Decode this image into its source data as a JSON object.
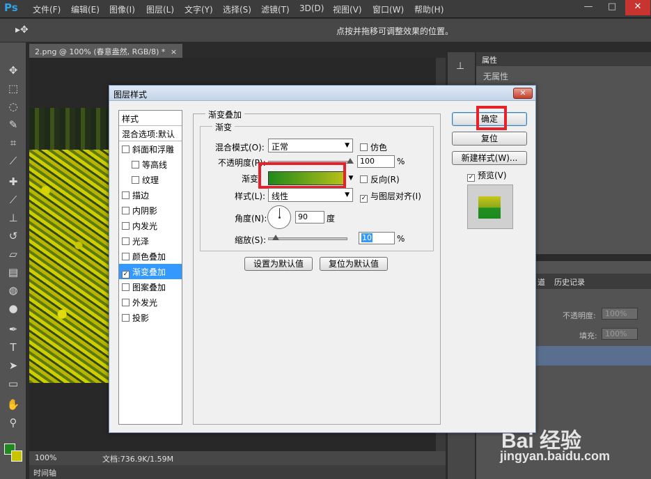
{
  "app": {
    "logo": "Ps",
    "menus": [
      "文件(F)",
      "编辑(E)",
      "图像(I)",
      "图层(L)",
      "文字(Y)",
      "选择(S)",
      "滤镜(T)",
      "3D(D)",
      "视图(V)",
      "窗口(W)",
      "帮助(H)"
    ],
    "window_buttons": [
      "—",
      "□",
      "✕"
    ]
  },
  "options_bar": {
    "hint": "点按并拖移可调整效果的位置。"
  },
  "document": {
    "tab_title": "2.png @ 100% (春意盎然, RGB/8) *",
    "tab_close": "×",
    "zoom": "100%",
    "doc_size": "文档:736.9K/1.59M",
    "timeline_tab": "时间轴"
  },
  "properties_panel": {
    "title": "属性",
    "content": "无属性"
  },
  "layers_panel": {
    "tabs": [
      "道",
      "历史记录"
    ],
    "opacity_label": "不透明度:",
    "opacity_value": "100%",
    "fill_label": "填充:",
    "fill_value": "100%",
    "layers": [
      "意盎然",
      "层 0"
    ]
  },
  "dialog": {
    "title": "图层样式",
    "close_glyph": "✕",
    "style_list": {
      "header": "样式",
      "blend_options": "混合选项:默认",
      "items": [
        {
          "label": "斜面和浮雕",
          "checked": false,
          "indent": false
        },
        {
          "label": "等高线",
          "checked": false,
          "indent": true
        },
        {
          "label": "纹理",
          "checked": false,
          "indent": true
        },
        {
          "label": "描边",
          "checked": false,
          "indent": false
        },
        {
          "label": "内阴影",
          "checked": false,
          "indent": false
        },
        {
          "label": "内发光",
          "checked": false,
          "indent": false
        },
        {
          "label": "光泽",
          "checked": false,
          "indent": false
        },
        {
          "label": "颜色叠加",
          "checked": false,
          "indent": false
        },
        {
          "label": "渐变叠加",
          "checked": true,
          "indent": false,
          "selected": true
        },
        {
          "label": "图案叠加",
          "checked": false,
          "indent": false
        },
        {
          "label": "外发光",
          "checked": false,
          "indent": false
        },
        {
          "label": "投影",
          "checked": false,
          "indent": false
        }
      ]
    },
    "gradient_overlay": {
      "group_title": "渐变叠加",
      "sub_title": "渐变",
      "blend_mode_label": "混合模式(O):",
      "blend_mode_value": "正常",
      "dither_label": "仿色",
      "dither_checked": false,
      "opacity_label": "不透明度(P):",
      "opacity_value": "100",
      "percent": "%",
      "gradient_label": "渐变:",
      "gradient_colors": [
        "#1f8a1a",
        "#b7c018"
      ],
      "reverse_label": "反向(R)",
      "reverse_checked": false,
      "style_label": "样式(L):",
      "style_value": "线性",
      "align_label": "与图层对齐(I)",
      "align_checked": true,
      "angle_label": "角度(N):",
      "angle_value": "90",
      "angle_unit": "度",
      "scale_label": "缩放(S):",
      "scale_value": "10",
      "opacity_slider": 1.0,
      "scale_slider": 0.1,
      "set_default_button": "设置为默认值",
      "reset_default_button": "复位为默认值"
    },
    "buttons": {
      "ok": "确定",
      "reset": "复位",
      "new_style": "新建样式(W)...",
      "preview_label": "预览(V)",
      "preview_checked": true
    }
  },
  "watermark": {
    "main": "Bai 经验",
    "url": "jingyan.baidu.com"
  }
}
